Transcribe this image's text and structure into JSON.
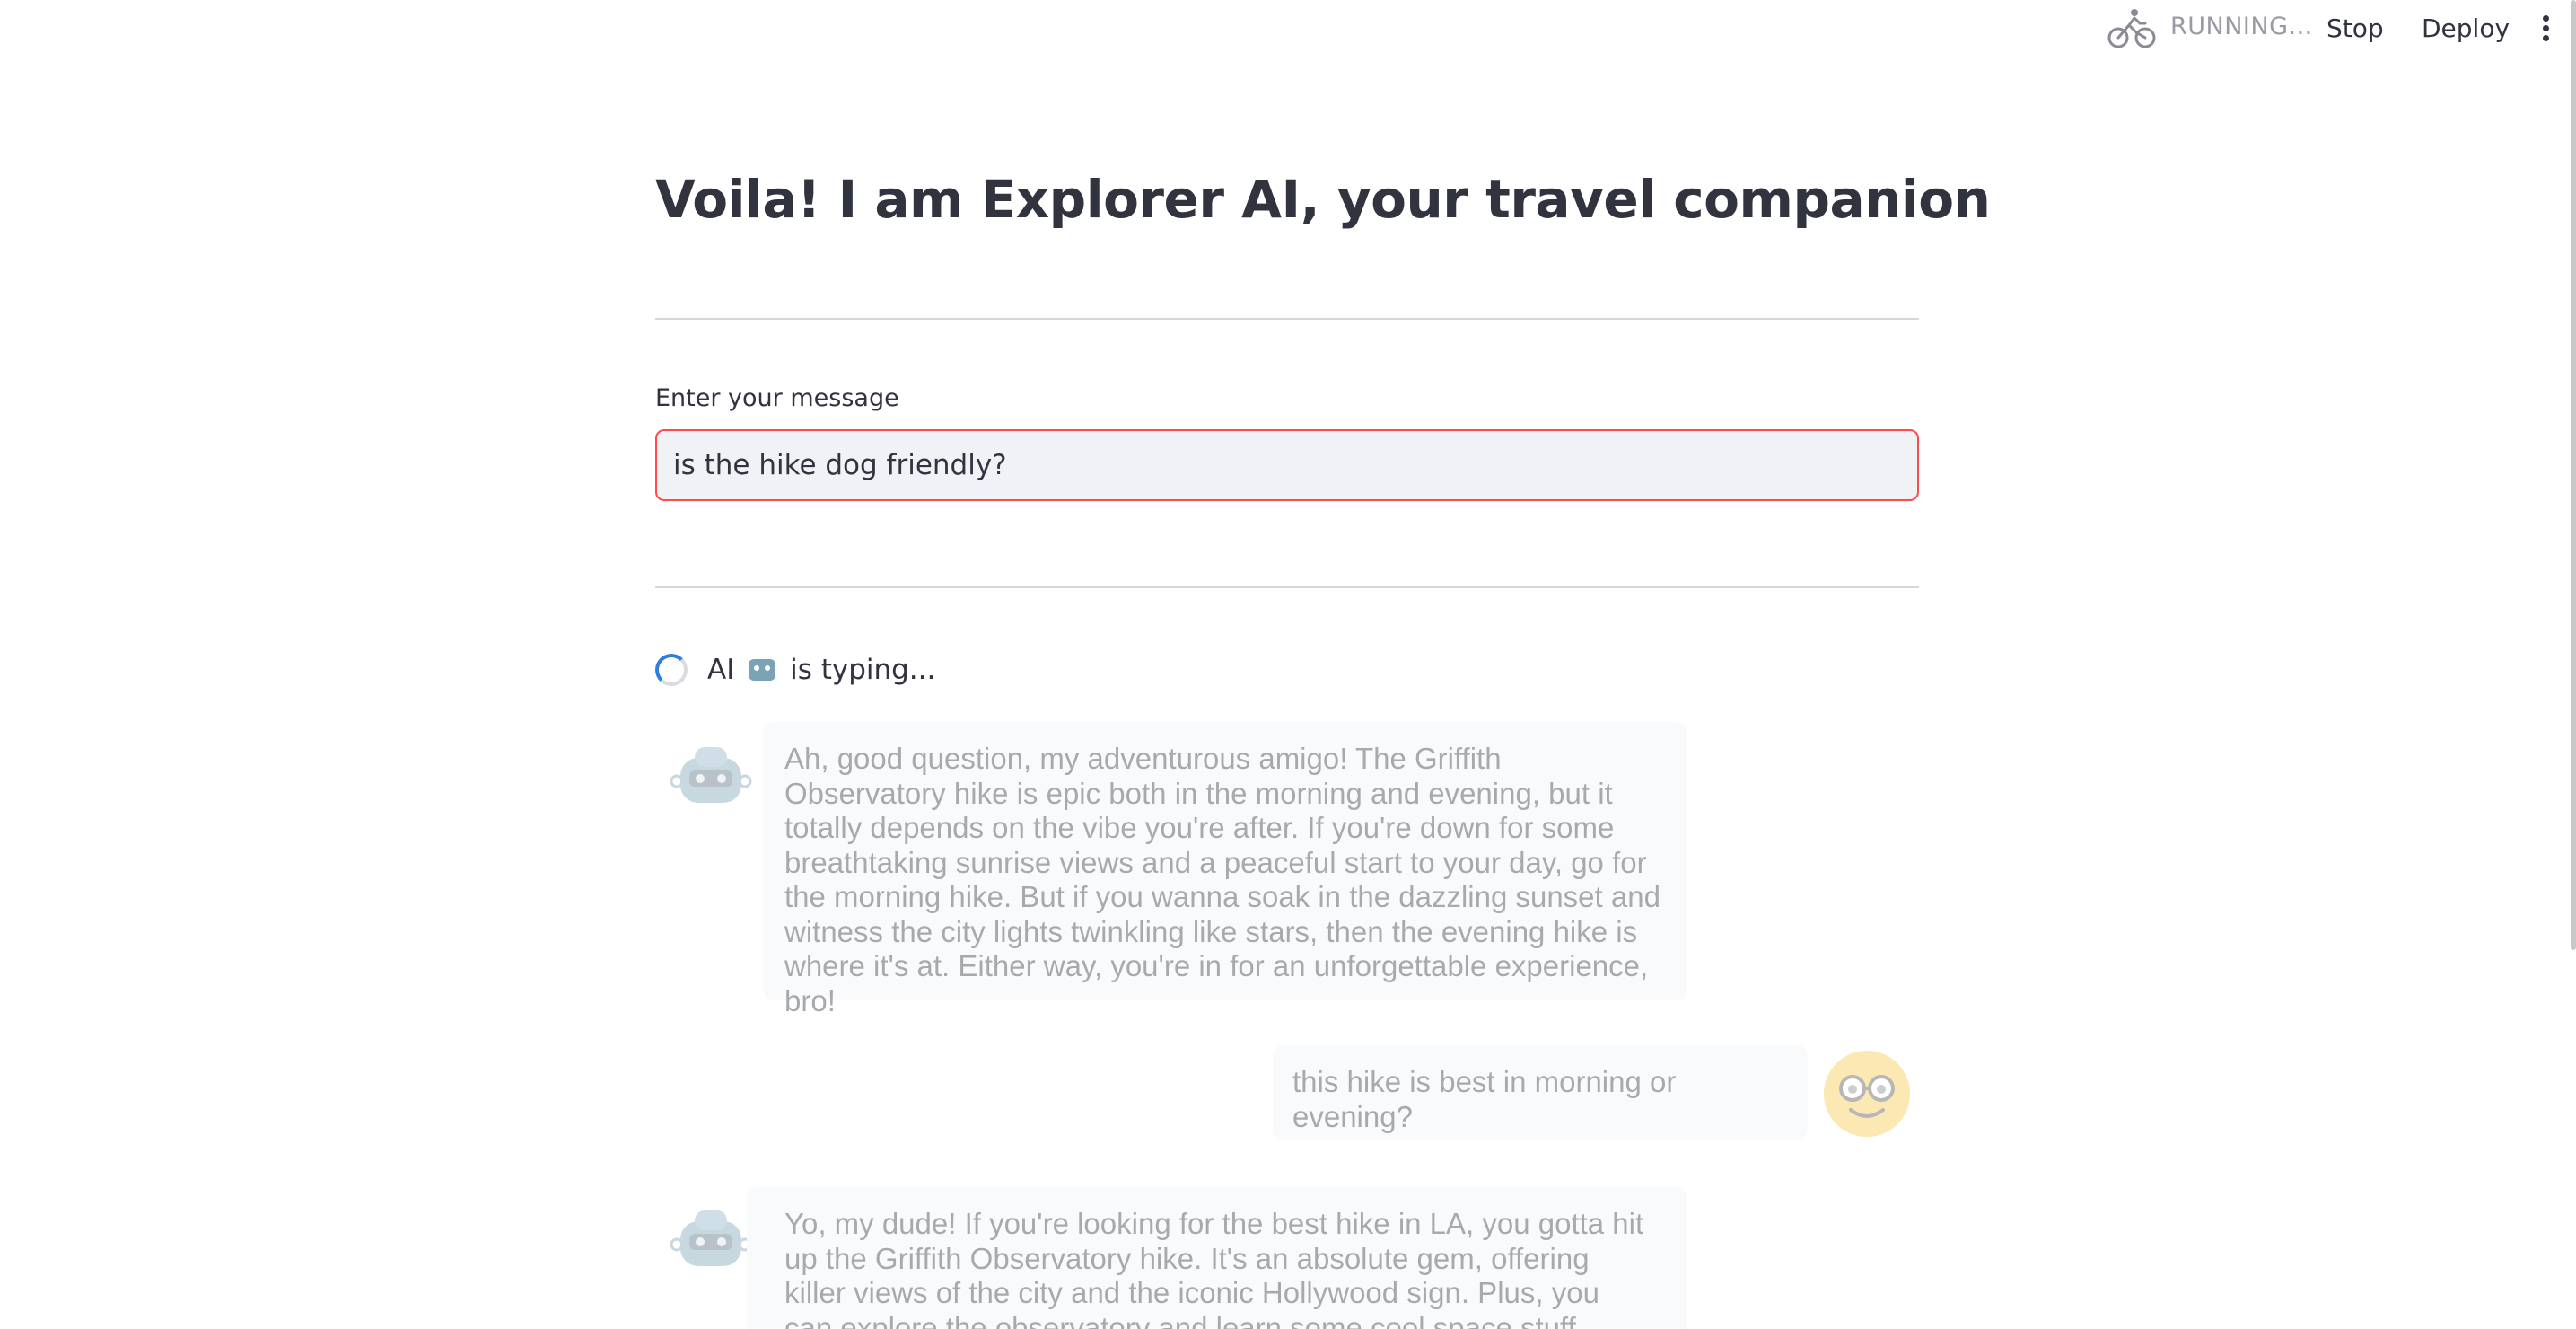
{
  "header": {
    "status_label": "RUNNING...",
    "stop_label": "Stop",
    "deploy_label": "Deploy",
    "status_icon": "bicycle-running-icon",
    "menu_icon": "vertical-dots-icon"
  },
  "main": {
    "title": "Voila! I am Explorer AI, your travel companion",
    "input_label": "Enter your message",
    "input_value": "is the hike dog friendly?",
    "typing_prefix": "AI",
    "typing_suffix": "is typing..."
  },
  "messages": [
    {
      "role": "assistant",
      "text": "Ah, good question, my adventurous amigo! The Griffith Observatory hike is epic both in the morning and evening, but it totally depends on the vibe you're after. If you're down for some breathtaking sunrise views and a peaceful start to your day, go for the morning hike. But if you wanna soak in the dazzling sunset and witness the city lights twinkling like stars, then the evening hike is where it's at. Either way, you're in for an unforgettable experience, bro!"
    },
    {
      "role": "user",
      "text": "this hike is best in morning or evening?"
    },
    {
      "role": "assistant",
      "text": "Yo, my dude! If you're looking for the best hike in LA, you gotta hit up the Griffith Observatory hike. It's an absolute gem, offering killer views of the city and the iconic Hollywood sign. Plus, you can explore the observatory and learn some cool space stuff. Trust me, it's a hike"
    }
  ],
  "colors": {
    "accent_red": "#ff4b4b",
    "spinner_blue": "#2e7de1",
    "bubble_bg": "#f0f2f6",
    "text": "#31333f",
    "user_avatar": "#f7c948",
    "bot_avatar": "#7ba3b8"
  }
}
